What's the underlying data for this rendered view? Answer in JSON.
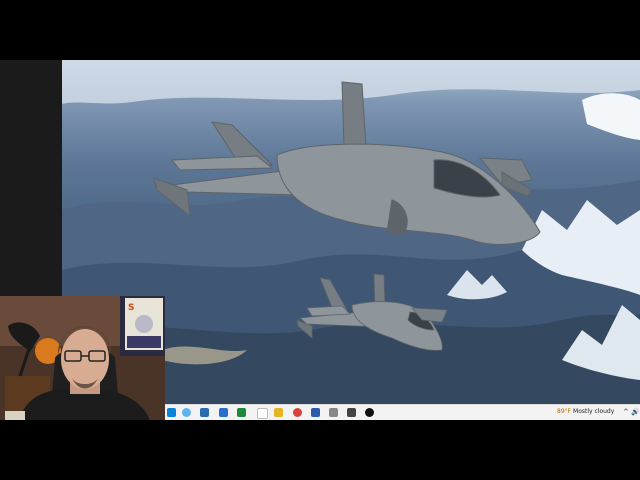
{
  "taskbar": {
    "weather_temp": "89°F",
    "weather_text": "Mostly cloudy",
    "pinned_icons": [
      "windows-start-icon",
      "search-icon",
      "task-view-icon",
      "store-icon",
      "mail-icon",
      "xbox-icon",
      "file-explorer-icon",
      "files-icon",
      "chrome-icon",
      "notepad-icon",
      "word-icon",
      "obs-icon"
    ],
    "tray_up_arrow": "^",
    "tray_volume": "🔊"
  },
  "colors": {
    "taskbar_bg": "#f3f3f3",
    "sky_top": "#b9c8d9",
    "jet_gray": "#8e969c"
  }
}
